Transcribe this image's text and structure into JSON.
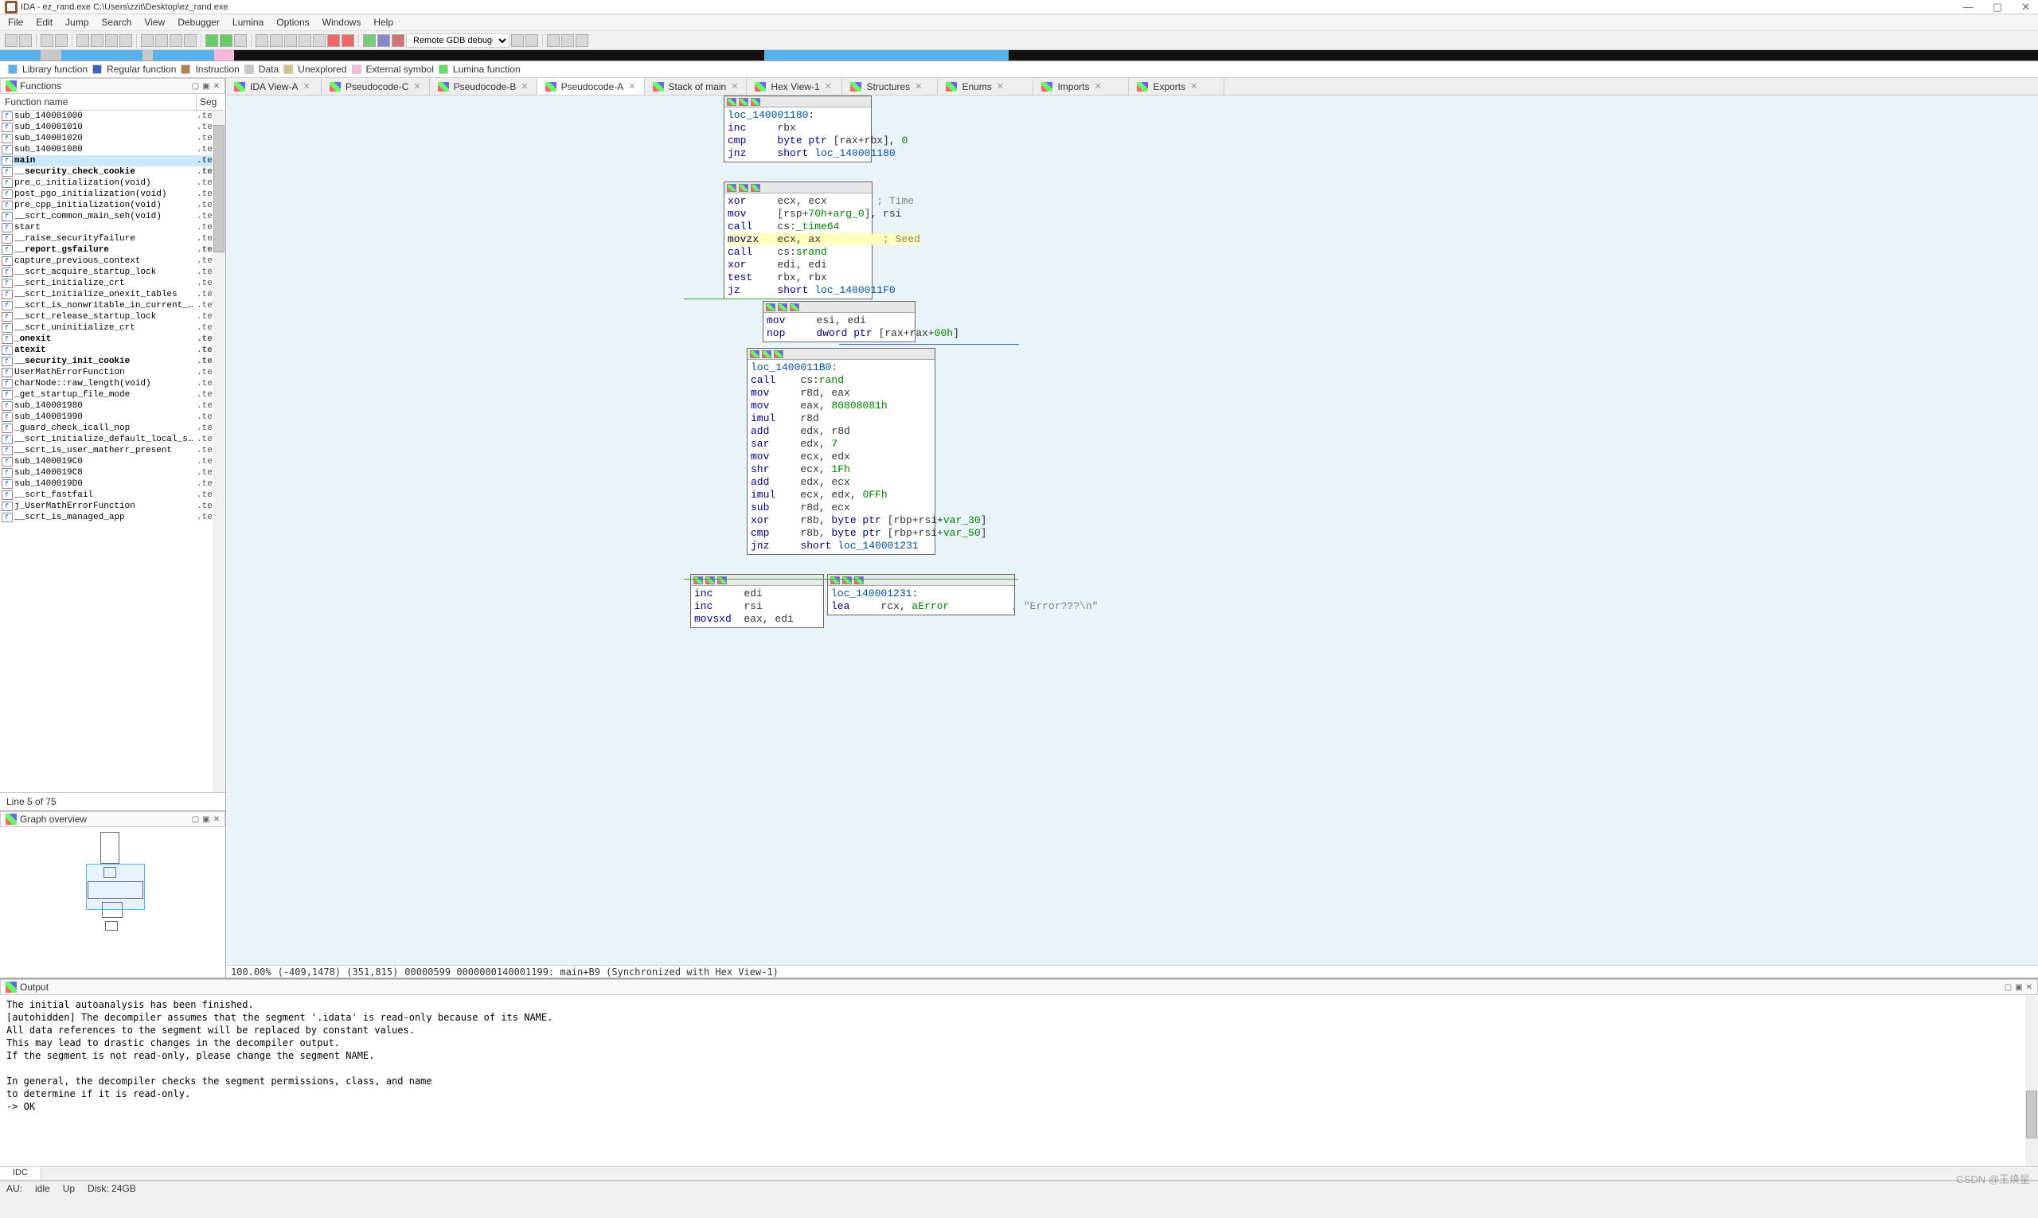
{
  "window": {
    "title": "IDA - ez_rand.exe C:\\Users\\zzit\\Desktop\\ez_rand.exe"
  },
  "menu": [
    "File",
    "Edit",
    "Jump",
    "Search",
    "View",
    "Debugger",
    "Lumina",
    "Options",
    "Windows",
    "Help"
  ],
  "debugger_dropdown": "Remote GDB debugger",
  "legend": [
    {
      "label": "Library function",
      "color": "lg-blue"
    },
    {
      "label": "Regular function",
      "color": "lg-dblue"
    },
    {
      "label": "Instruction",
      "color": "lg-brown"
    },
    {
      "label": "Data",
      "color": "lg-gray"
    },
    {
      "label": "Unexplored",
      "color": "lg-khaki"
    },
    {
      "label": "External symbol",
      "color": "lg-pink"
    },
    {
      "label": "Lumina function",
      "color": "lg-green"
    }
  ],
  "functions_panel": {
    "title": "Functions",
    "col1": "Function name",
    "col2": "Seg",
    "rows": [
      {
        "n": "sub_140001000",
        "s": ".tex",
        "bold": false
      },
      {
        "n": "sub_140001010",
        "s": ".tex",
        "bold": false
      },
      {
        "n": "sub_140001020",
        "s": ".tex",
        "bold": false
      },
      {
        "n": "sub_140001080",
        "s": ".tex",
        "bold": false
      },
      {
        "n": "main",
        "s": ".te",
        "bold": true,
        "sel": true
      },
      {
        "n": "__security_check_cookie",
        "s": ".te",
        "bold": true
      },
      {
        "n": "pre_c_initialization(void)",
        "s": ".tex",
        "bold": false
      },
      {
        "n": "post_pgo_initialization(void)",
        "s": ".tex",
        "bold": false
      },
      {
        "n": "pre_cpp_initialization(void)",
        "s": ".tex",
        "bold": false
      },
      {
        "n": "__scrt_common_main_seh(void)",
        "s": ".tex",
        "bold": false
      },
      {
        "n": "start",
        "s": ".tex",
        "bold": false
      },
      {
        "n": "__raise_securityfailure",
        "s": ".tex",
        "bold": false
      },
      {
        "n": "__report_gsfailure",
        "s": ".te",
        "bold": true
      },
      {
        "n": "capture_previous_context",
        "s": ".tex",
        "bold": false
      },
      {
        "n": "__scrt_acquire_startup_lock",
        "s": ".tex",
        "bold": false
      },
      {
        "n": "__scrt_initialize_crt",
        "s": ".tex",
        "bold": false
      },
      {
        "n": "__scrt_initialize_onexit_tables",
        "s": ".tex",
        "bold": false
      },
      {
        "n": "__scrt_is_nonwritable_in_current_image",
        "s": ".tex",
        "bold": false
      },
      {
        "n": "__scrt_release_startup_lock",
        "s": ".tex",
        "bold": false
      },
      {
        "n": "__scrt_uninitialize_crt",
        "s": ".tex",
        "bold": false
      },
      {
        "n": "_onexit",
        "s": ".te",
        "bold": true
      },
      {
        "n": "atexit",
        "s": ".te",
        "bold": true
      },
      {
        "n": "__security_init_cookie",
        "s": ".te",
        "bold": true
      },
      {
        "n": "UserMathErrorFunction",
        "s": ".tex",
        "bold": false
      },
      {
        "n": "charNode::raw_length(void)",
        "s": ".tex",
        "bold": false
      },
      {
        "n": "_get_startup_file_mode",
        "s": ".tex",
        "bold": false
      },
      {
        "n": "sub_140001980",
        "s": ".tex",
        "bold": false
      },
      {
        "n": "sub_140001990",
        "s": ".tex",
        "bold": false
      },
      {
        "n": "_guard_check_icall_nop",
        "s": ".tex",
        "bold": false
      },
      {
        "n": "__scrt_initialize_default_local_stdio_options",
        "s": ".tex",
        "bold": false
      },
      {
        "n": "__scrt_is_user_matherr_present",
        "s": ".tex",
        "bold": false
      },
      {
        "n": "sub_1400019C0",
        "s": ".tex",
        "bold": false
      },
      {
        "n": "sub_1400019C8",
        "s": ".tex",
        "bold": false
      },
      {
        "n": "sub_1400019D0",
        "s": ".tex",
        "bold": false
      },
      {
        "n": "__scrt_fastfail",
        "s": ".tex",
        "bold": false
      },
      {
        "n": "j_UserMathErrorFunction",
        "s": ".tex",
        "bold": false
      },
      {
        "n": "__scrt_is_managed_app",
        "s": ".tex",
        "bold": false
      }
    ],
    "status": "Line 5 of 75"
  },
  "graph_overview_title": "Graph overview",
  "tabs": [
    "IDA View-A",
    "Pseudocode-C",
    "Pseudocode-B",
    "Pseudocode-A",
    "Stack of main",
    "Hex View-1",
    "Structures",
    "Enums",
    "Imports",
    "Exports"
  ],
  "active_tab": 3,
  "nodes": {
    "n1": {
      "lines": [
        "",
        "<lbl>loc_140001180</lbl>:",
        "<mn>inc    </mn> rbx",
        "<mn>cmp    </mn> <kw>byte ptr</kw> [rax+rbx], <num>0</num>",
        "<mn>jnz    </mn> <kw>short</kw> <lbl>loc_140001180</lbl>"
      ]
    },
    "n2": {
      "lines": [
        "<mn>xor    </mn> ecx, ecx        <cm>; Time</cm>",
        "<mn>mov    </mn> [rsp+<num>70h</num>+<fn>arg_0</fn>], rsi",
        "<mn>call   </mn> cs:<fn>_time64</fn>",
        "<hl><mn>movzx  </mn> ecx, ax          <cm>; Seed</cm></hl>",
        "<mn>call   </mn> cs:<fn>srand</fn>",
        "<mn>xor    </mn> edi, edi",
        "<mn>test   </mn> rbx, rbx",
        "<mn>jz     </mn> <kw>short</kw> <lbl>loc_1400011F0</lbl>"
      ]
    },
    "n3": {
      "lines": [
        "<mn>mov    </mn> esi, edi",
        "<mn>nop    </mn> <kw>dword ptr</kw> [rax+rax+<num>00h</num>]"
      ]
    },
    "n4": {
      "lines": [
        "",
        "<lbl>loc_1400011B0</lbl>:",
        "<mn>call   </mn> cs:<fn>rand</fn>",
        "<mn>mov    </mn> r8d, eax",
        "<mn>mov    </mn> eax, <num>80808081h</num>",
        "<mn>imul   </mn> r8d",
        "<mn>add    </mn> edx, r8d",
        "<mn>sar    </mn> edx, <num>7</num>",
        "<mn>mov    </mn> ecx, edx",
        "<mn>shr    </mn> ecx, <num>1Fh</num>",
        "<mn>add    </mn> edx, ecx",
        "<mn>imul   </mn> ecx, edx, <num>0FFh</num>",
        "<mn>sub    </mn> r8d, ecx",
        "<mn>xor    </mn> r8b, <kw>byte ptr</kw> [rbp+rsi+<fn>var_30</fn>]",
        "<mn>cmp    </mn> r8b, <kw>byte ptr</kw> [rbp+rsi+<fn>var_50</fn>]",
        "<mn>jnz    </mn> <kw>short</kw> <lbl>loc_140001231</lbl>"
      ]
    },
    "n5": {
      "lines": [
        "<mn>inc    </mn> edi",
        "<mn>inc    </mn> rsi",
        "<mn>movsxd </mn> eax, edi"
      ]
    },
    "n6": {
      "lines": [
        "",
        "<lbl>loc_140001231</lbl>:",
        "<mn>lea    </mn> rcx, <fn>aError</fn>          <cm>; \"Error???\\n\"</cm>"
      ]
    }
  },
  "coord": {
    "zoom": "100.00%",
    "xy": "(-409,1478) (351,815)",
    "addr": "00000599 0000000140001199: main+B9 (Synchronized with Hex View-1)"
  },
  "output": {
    "title": "Output",
    "lines": [
      "The initial autoanalysis has been finished.",
      "[autohidden] The decompiler assumes that the segment '.idata' is read-only because of its NAME.",
      "All data references to the segment will be replaced by constant values.",
      "This may lead to drastic changes in the decompiler output.",
      "If the segment is not read-only, please change the segment NAME.",
      "",
      "In general, the decompiler checks the segment permissions, class, and name",
      "to determine if it is read-only.",
      " -> OK"
    ],
    "idc": "IDC"
  },
  "statusbar": {
    "au": "AU:",
    "state": "idle",
    "dir": "Up",
    "disk": "Disk: 24GB"
  },
  "watermark": "CSDN @王焕星"
}
